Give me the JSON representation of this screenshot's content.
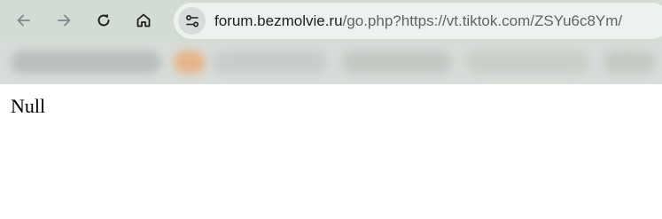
{
  "browser": {
    "nav": {
      "back_icon": "arrow-left-icon",
      "forward_icon": "arrow-right-icon",
      "reload_icon": "reload-icon",
      "home_icon": "home-icon"
    },
    "omnibox": {
      "site_info_icon": "tune-icon",
      "url_host": "forum.bezmolvie.ru",
      "url_path": "/go.php?https://vt.tiktok.com/ZSYu6c8Ym/"
    },
    "bookmarks_bar": {
      "state": "blurred"
    }
  },
  "page": {
    "text": "Null"
  },
  "colors": {
    "toolbar_bg": "#d3dbd5",
    "omnibox_bg": "#eef2ef",
    "bookmarks_bg": "#d8ddd9",
    "icon_active": "#1f1f1f",
    "icon_disabled": "#80868b",
    "url_path_color": "#5f6368"
  }
}
